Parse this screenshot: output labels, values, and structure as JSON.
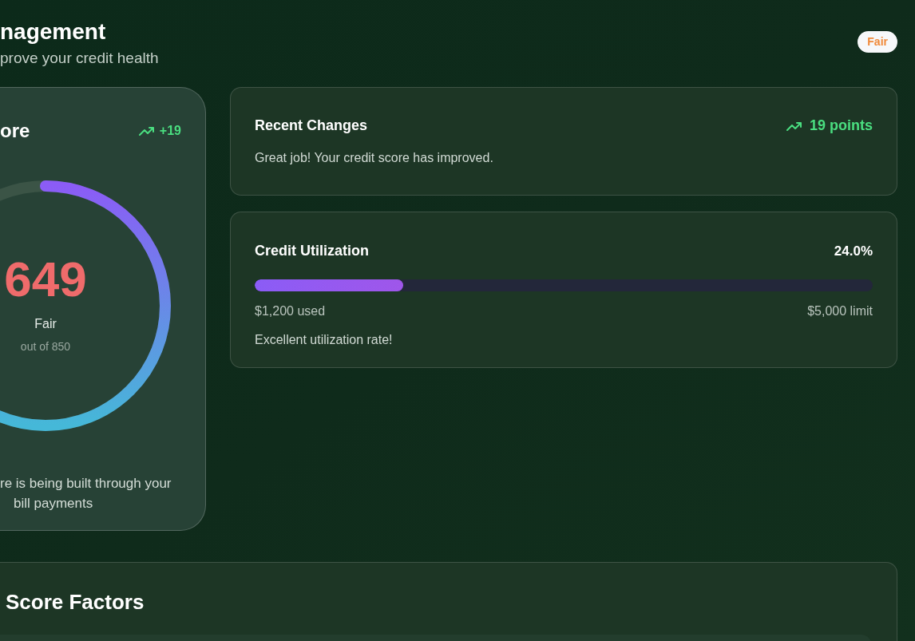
{
  "header": {
    "title": "nagement",
    "subtitle": "prove your credit health",
    "badge": "Fair"
  },
  "score_card": {
    "title": "ore",
    "change": "+19",
    "gauge": {
      "level": 0.63
    },
    "score": "649",
    "rating": "Fair",
    "scale": "out of 850",
    "note_lines": [
      "re is being built through your",
      "bill payments"
    ]
  },
  "recent_changes": {
    "title": "Recent Changes",
    "change": "19 points",
    "message": "Great job! Your credit score has improved."
  },
  "utilization": {
    "title": "Credit Utilization",
    "percent": "24.0%",
    "bar": {
      "level": 0.24
    },
    "used": "$1,200 used",
    "limit": "$5,000 limit",
    "message": "Excellent utilization rate!"
  },
  "factors": {
    "title": "Score Factors"
  }
}
